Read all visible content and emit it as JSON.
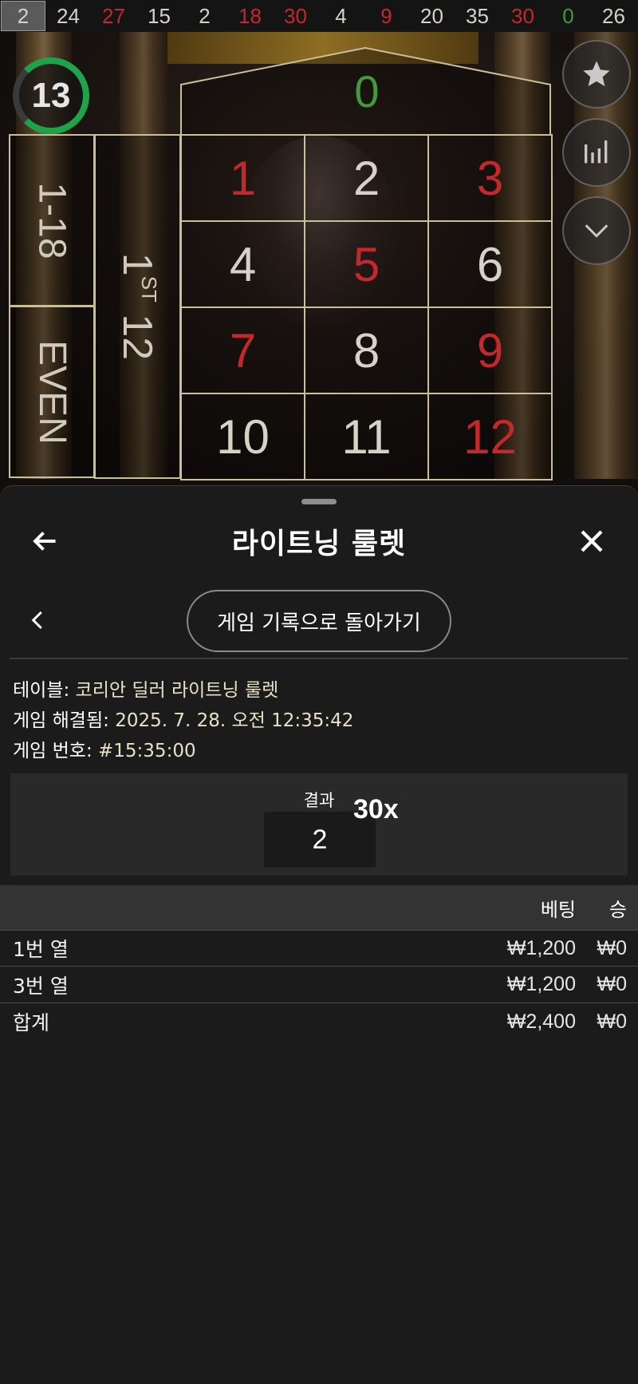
{
  "history": [
    {
      "value": "2",
      "color": "black",
      "highlight": true
    },
    {
      "value": "24",
      "color": "black"
    },
    {
      "value": "27",
      "color": "red"
    },
    {
      "value": "15",
      "color": "black"
    },
    {
      "value": "2",
      "color": "black"
    },
    {
      "value": "18",
      "color": "red"
    },
    {
      "value": "30",
      "color": "red"
    },
    {
      "value": "4",
      "color": "black"
    },
    {
      "value": "9",
      "color": "red"
    },
    {
      "value": "20",
      "color": "black"
    },
    {
      "value": "35",
      "color": "black"
    },
    {
      "value": "30",
      "color": "red"
    },
    {
      "value": "0",
      "color": "green"
    },
    {
      "value": "26",
      "color": "black"
    }
  ],
  "timer": "13",
  "table": {
    "zero": "0",
    "numbers": [
      {
        "n": "1",
        "color": "red"
      },
      {
        "n": "2",
        "color": "black"
      },
      {
        "n": "3",
        "color": "red"
      },
      {
        "n": "4",
        "color": "black"
      },
      {
        "n": "5",
        "color": "red"
      },
      {
        "n": "6",
        "color": "black"
      },
      {
        "n": "7",
        "color": "red"
      },
      {
        "n": "8",
        "color": "black"
      },
      {
        "n": "9",
        "color": "red"
      },
      {
        "n": "10",
        "color": "black"
      },
      {
        "n": "11",
        "color": "black"
      },
      {
        "n": "12",
        "color": "red"
      }
    ],
    "low_bet": "1-18",
    "even_bet": "EVEN",
    "dozen_main": "1",
    "dozen_sup": "ST",
    "dozen_num": "12"
  },
  "side_buttons": {
    "favorite_icon": "star-icon",
    "stats_icon": "stats-icon",
    "collapse_icon": "chevron-down-icon"
  },
  "sheet": {
    "title": "라이트닝 룰렛",
    "back_icon": "arrow-left-icon",
    "close_icon": "close-icon",
    "prev_icon": "chevron-left-icon",
    "return_label": "게임 기록으로 돌아가기"
  },
  "details": {
    "table_label": "테이블:",
    "table_value": "코리안 딜러 라이트닝 룰렛",
    "resolved_label": "게임 해결됨:",
    "resolved_value": "2025. 7. 28. 오전 12:35:42",
    "game_no_label": "게임 번호:",
    "game_no_value": "#15:35:00"
  },
  "result": {
    "label": "결과",
    "number": "2",
    "multiplier": "30x"
  },
  "bets": {
    "header_bet": "베팅",
    "header_win": "승",
    "rows": [
      {
        "name": "1번 열",
        "bet": "₩1,200",
        "win": "₩0"
      },
      {
        "name": "3번 열",
        "bet": "₩1,200",
        "win": "₩0"
      }
    ],
    "total": {
      "name": "합계",
      "bet": "₩2,400",
      "win": "₩0"
    }
  },
  "colors": {
    "red": "#c4282b",
    "black_text": "#d6d2c8",
    "green": "#3f9b3c",
    "timer_ring": "#1ea34a",
    "sheet_bg": "#1b1b1b"
  }
}
